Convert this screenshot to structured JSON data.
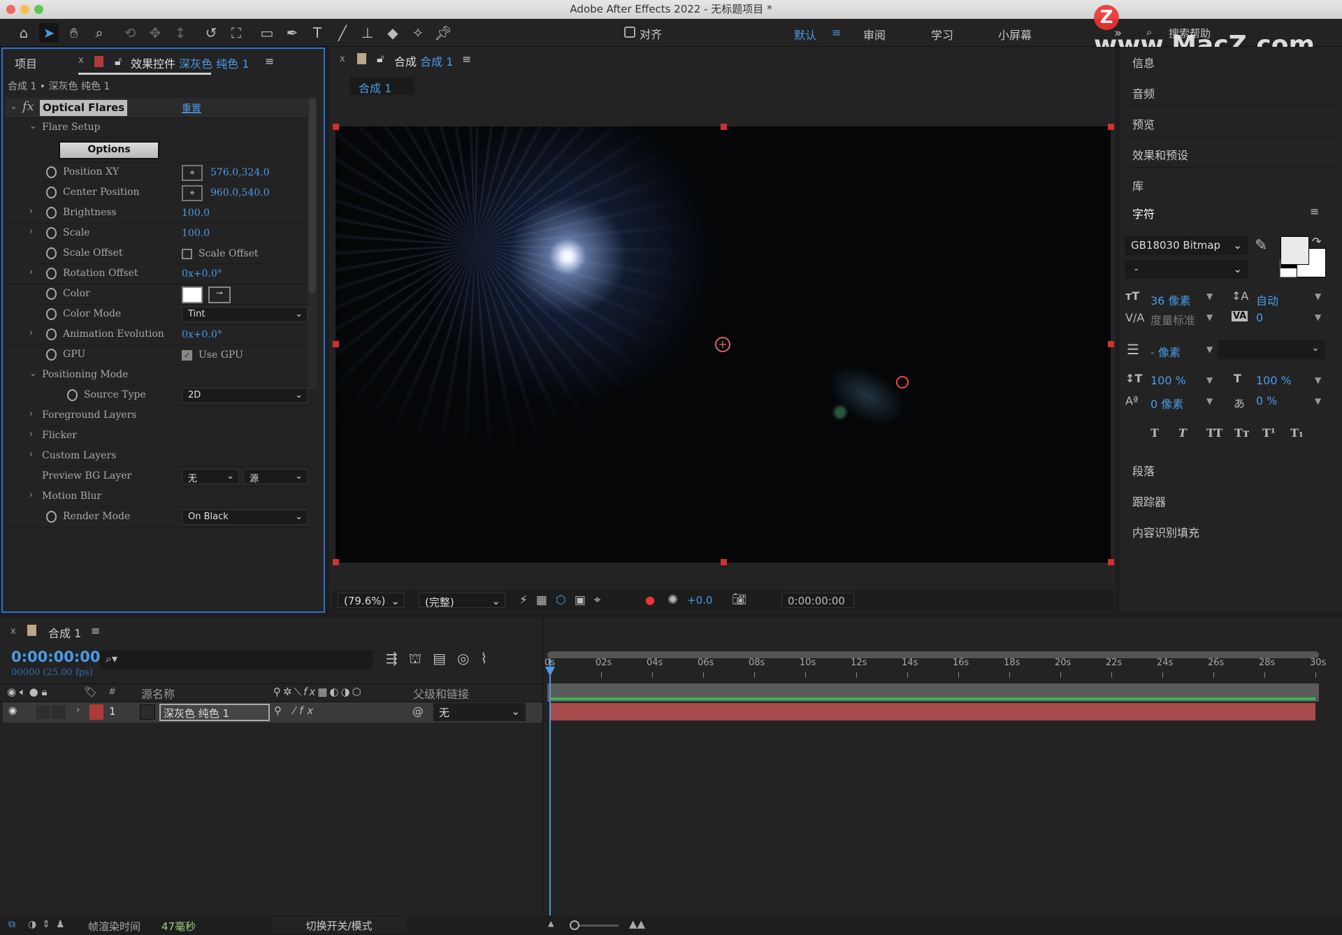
{
  "window": {
    "title": "Adobe After Effects 2022 - 无标题项目 *"
  },
  "toolbar": {
    "tools": [
      "home-icon",
      "selection-icon",
      "hand-icon",
      "zoom-icon",
      "orbit-icon",
      "pan-icon",
      "dolly-icon",
      "rotate-icon",
      "anchor-icon",
      "rectangle-icon",
      "pen-icon",
      "text-icon",
      "brush-icon",
      "stamp-icon",
      "eraser-icon",
      "roto-icon",
      "puppet-icon"
    ],
    "snap_label": "对齐",
    "workspaces": [
      "默认",
      "审阅",
      "学习",
      "小屏幕"
    ],
    "active_workspace": "默认",
    "search_placeholder": "搜索帮助",
    "watermark": "www.MacZ.com"
  },
  "left_panel": {
    "tab_project": "项目",
    "tab_effects": "效果控件",
    "tab_effects_layer": "深灰色 纯色 1",
    "breadcrumb": "合成 1 • 深灰色 纯色 1",
    "effect_name": "Optical Flares",
    "reset_label": "重置",
    "options_label": "Options",
    "rows": [
      {
        "label": "Flare Setup",
        "indent": 1,
        "twirl": "open"
      },
      {
        "label": "Position XY",
        "value": "576.0,324.0",
        "kind": "point"
      },
      {
        "label": "Center Position",
        "value": "960.0,540.0",
        "kind": "point"
      },
      {
        "label": "Brightness",
        "value": "100.0",
        "twirl": "closed"
      },
      {
        "label": "Scale",
        "value": "100.0",
        "twirl": "closed"
      },
      {
        "label": "Scale Offset",
        "value": "Scale Offset",
        "kind": "checkbox",
        "checked": false
      },
      {
        "label": "Rotation Offset",
        "value": "0x+0.0°",
        "twirl": "closed"
      },
      {
        "label": "Color",
        "kind": "color",
        "color": "#ffffff"
      },
      {
        "label": "Color Mode",
        "value": "Tint",
        "kind": "select"
      },
      {
        "label": "Animation Evolution",
        "value": "0x+0.0°",
        "twirl": "closed"
      },
      {
        "label": "GPU",
        "value": "Use GPU",
        "kind": "checkbox",
        "checked": true
      },
      {
        "label": "Positioning Mode",
        "indent": 1,
        "twirl": "open"
      },
      {
        "label": "Source Type",
        "value": "2D",
        "kind": "select",
        "indent": 2
      },
      {
        "label": "Foreground Layers",
        "indent": 1,
        "twirl": "closed"
      },
      {
        "label": "Flicker",
        "indent": 1,
        "twirl": "closed"
      },
      {
        "label": "Custom Layers",
        "indent": 1,
        "twirl": "closed"
      },
      {
        "label": "Preview BG Layer",
        "indent": 1,
        "kind": "select2",
        "value": "无",
        "value2": "源"
      },
      {
        "label": "Motion Blur",
        "indent": 1,
        "twirl": "closed"
      },
      {
        "label": "Render Mode",
        "value": "On Black",
        "kind": "select"
      }
    ]
  },
  "comp_panel": {
    "tab_label": "合成",
    "tab_comp": "合成 1",
    "sub_tab": "合成 1",
    "zoom": "(79.6%)",
    "resolution": "(完整)",
    "exposure": "+0.0",
    "timecode": "0:00:00:00"
  },
  "right_panel": {
    "items_top": [
      "信息",
      "音频",
      "预览",
      "效果和预设",
      "库"
    ],
    "character_title": "字符",
    "font": "GB18030 Bitmap",
    "font_style": "-",
    "size": "36 像素",
    "leading": "自动",
    "kerning": "度量标准",
    "tracking": "0",
    "stroke": "- 像素",
    "vscale": "100 %",
    "hscale": "100 %",
    "baseline": "0 像素",
    "tsume": "0 %",
    "styles": [
      "T",
      "T",
      "TT",
      "Tт",
      "T¹",
      "T₁"
    ],
    "items_bottom": [
      "段落",
      "跟踪器",
      "内容识别填充"
    ]
  },
  "timeline": {
    "tab": "合成 1",
    "timecode": "0:00:00:00",
    "frames": "00000 (25.00 fps)",
    "col_source": "源名称",
    "col_parent": "父级和链接",
    "col_num": "#",
    "ruler": [
      "0s",
      "02s",
      "04s",
      "06s",
      "08s",
      "10s",
      "12s",
      "14s",
      "16s",
      "18s",
      "20s",
      "22s",
      "24s",
      "26s",
      "28s",
      "30s"
    ],
    "layers": [
      {
        "num": "1",
        "name": "深灰色 纯色 1",
        "parent": "无",
        "label_color": "#b03a3a"
      }
    ]
  },
  "status": {
    "render_label": "帧渲染时间",
    "render_time": "47毫秒",
    "toggle_label": "切换开关/模式"
  }
}
